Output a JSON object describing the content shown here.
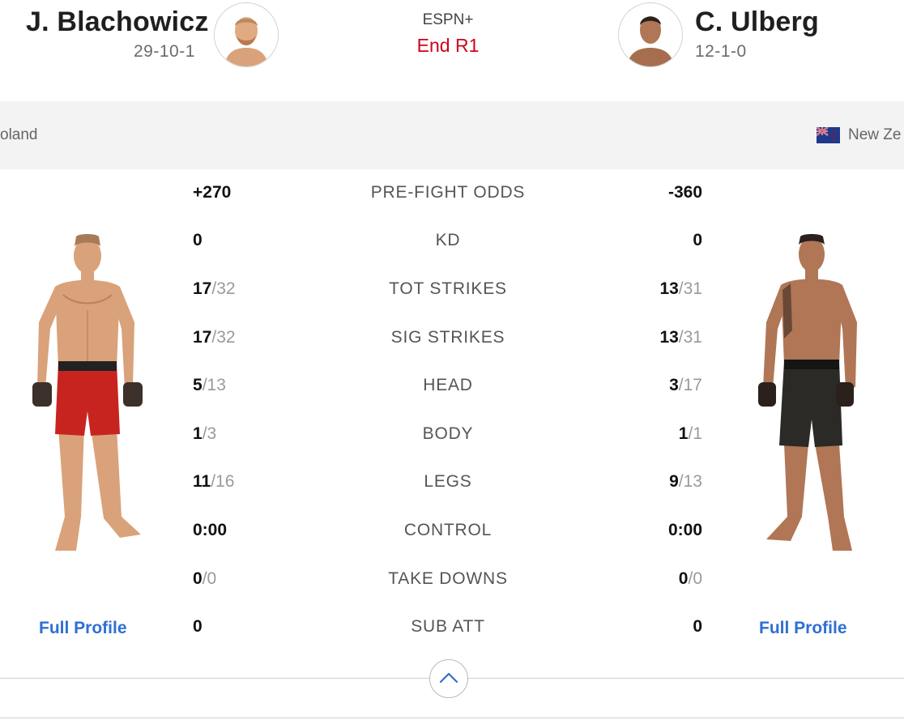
{
  "header": {
    "left": {
      "name": "J. Blachowicz",
      "record": "29-10-1"
    },
    "center": {
      "network": "ESPN+",
      "status": "End R1"
    },
    "right": {
      "name": "C. Ulberg",
      "record": "12-1-0"
    }
  },
  "countries": {
    "left": "oland",
    "right": "New Ze"
  },
  "stats": [
    {
      "label": "PRE-FIGHT ODDS",
      "left": {
        "main": "+270",
        "sub": ""
      },
      "right": {
        "main": "-360",
        "sub": ""
      }
    },
    {
      "label": "KD",
      "left": {
        "main": "0",
        "sub": ""
      },
      "right": {
        "main": "0",
        "sub": ""
      }
    },
    {
      "label": "TOT STRIKES",
      "left": {
        "main": "17",
        "sub": "/32"
      },
      "right": {
        "main": "13",
        "sub": "/31"
      }
    },
    {
      "label": "SIG STRIKES",
      "left": {
        "main": "17",
        "sub": "/32"
      },
      "right": {
        "main": "13",
        "sub": "/31"
      }
    },
    {
      "label": "HEAD",
      "left": {
        "main": "5",
        "sub": "/13"
      },
      "right": {
        "main": "3",
        "sub": "/17"
      }
    },
    {
      "label": "BODY",
      "left": {
        "main": "1",
        "sub": "/3"
      },
      "right": {
        "main": "1",
        "sub": "/1"
      }
    },
    {
      "label": "LEGS",
      "left": {
        "main": "11",
        "sub": "/16"
      },
      "right": {
        "main": "9",
        "sub": "/13"
      }
    },
    {
      "label": "CONTROL",
      "left": {
        "main": "0:00",
        "sub": ""
      },
      "right": {
        "main": "0:00",
        "sub": ""
      }
    },
    {
      "label": "TAKE DOWNS",
      "left": {
        "main": "0",
        "sub": "/0"
      },
      "right": {
        "main": "0",
        "sub": "/0"
      }
    },
    {
      "label": "SUB ATT",
      "left": {
        "main": "0",
        "sub": ""
      },
      "right": {
        "main": "0",
        "sub": ""
      }
    }
  ],
  "links": {
    "left_profile": "Full Profile",
    "right_profile": "Full Profile"
  },
  "colors": {
    "accent": "#2f6fd2",
    "status": "#d0021b",
    "left_shorts": "#c8241f",
    "right_shorts": "#2b2a26",
    "skin": "#d9a27a"
  },
  "icons": {
    "collapse": "chevron-up-icon",
    "flag": "new-zealand-flag-icon"
  }
}
